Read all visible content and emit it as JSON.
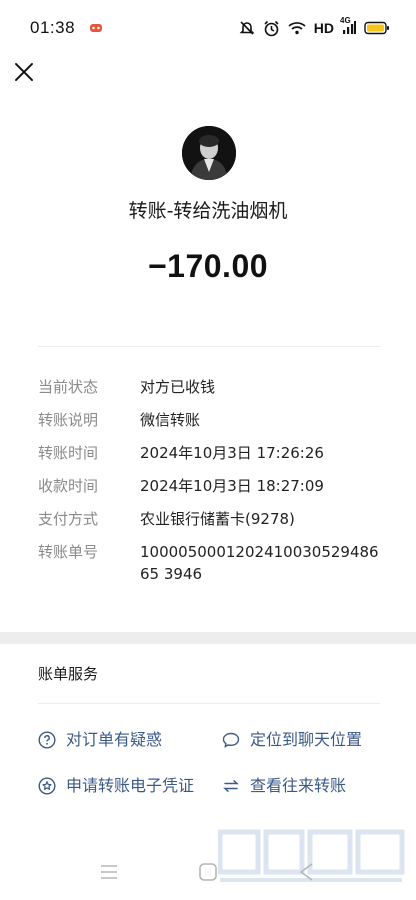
{
  "status_bar": {
    "time": "01:38",
    "network_label": "HD",
    "signal_label": "4G"
  },
  "icons": {
    "close": "close-icon",
    "status_notif": "game-controller-icon",
    "mute": "bell-slash-icon",
    "alarm": "alarm-icon",
    "wifi": "wifi-icon",
    "battery": "battery-icon"
  },
  "transfer": {
    "title": "转账-转给洗油烟机",
    "amount": "−170.00"
  },
  "details": [
    {
      "label": "当前状态",
      "value": "对方已收钱"
    },
    {
      "label": "转账说明",
      "value": "微信转账"
    },
    {
      "label": "转账时间",
      "value": "2024年10月3日 17:26:26"
    },
    {
      "label": "收款时间",
      "value": "2024年10月3日 18:27:09"
    },
    {
      "label": "支付方式",
      "value": "农业银行储蓄卡(9278)"
    },
    {
      "label": "转账单号",
      "value": "100005000120241003052948665 3946"
    }
  ],
  "services": {
    "header": "账单服务",
    "items": [
      {
        "label": "对订单有疑惑",
        "icon": "question-circle-icon"
      },
      {
        "label": "定位到聊天位置",
        "icon": "chat-bubble-icon"
      },
      {
        "label": "申请转账电子凭证",
        "icon": "badge-star-icon"
      },
      {
        "label": "查看往来转账",
        "icon": "swap-arrows-icon"
      }
    ]
  },
  "colors": {
    "link": "#3b5a88",
    "label_gray": "#8a8a8a",
    "section_bg": "#ededed",
    "battery": "#f5c518"
  }
}
